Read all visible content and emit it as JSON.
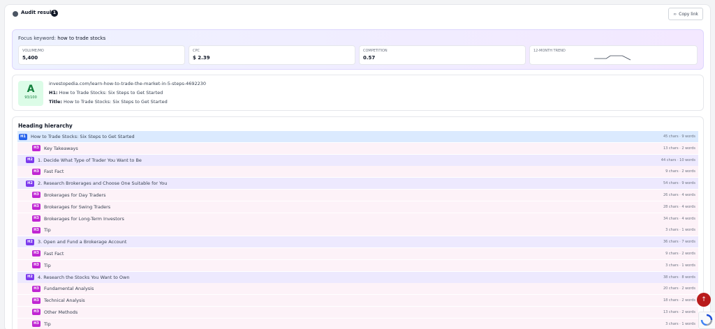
{
  "header": {
    "title": "Audit results",
    "count": "1",
    "copy_label": "Copy link"
  },
  "keyword": {
    "label": "Focus keyword:",
    "value": "how to trade stocks",
    "metrics": [
      {
        "label": "VOLUME/MO",
        "value": "5,400"
      },
      {
        "label": "CPC",
        "value": "$ 2.39"
      },
      {
        "label": "COMPETITION",
        "value": "0.57"
      },
      {
        "label": "12-MONTH TREND",
        "value": ""
      }
    ],
    "trend_values": [
      0.2,
      0.2,
      0.2,
      0.2,
      0.6,
      0.6,
      0.6,
      0.6,
      0.3,
      0.0
    ]
  },
  "page": {
    "grade": "A",
    "score": "93/100",
    "url": "investopedia.com/learn-how-to-trade-the-market-in-5-steps-4692230",
    "h1_label": "H1:",
    "h1": "How to Trade Stocks: Six Steps to Get Started",
    "title_label": "Title:",
    "title": "How to Trade Stocks: Six Steps to Get Started"
  },
  "hierarchy": {
    "title": "Heading hierarchy",
    "rows": [
      {
        "level": "H1",
        "text": "How to Trade Stocks: Six Steps to Get Started",
        "meta": "45 chars · 9 words"
      },
      {
        "level": "H3",
        "text": "Key Takeaways",
        "meta": "13 chars · 2 words"
      },
      {
        "level": "H2",
        "text": "1. Decide What Type of Trader You Want to Be",
        "meta": "44 chars · 10 words"
      },
      {
        "level": "H3",
        "text": "Fast Fact",
        "meta": "9 chars · 2 words"
      },
      {
        "level": "H2",
        "text": "2. Research Brokerages and Choose One Suitable for You",
        "meta": "54 chars · 9 words"
      },
      {
        "level": "H3",
        "text": "Brokerages for Day Traders",
        "meta": "26 chars · 4 words"
      },
      {
        "level": "H3",
        "text": "Brokerages for Swing Traders",
        "meta": "28 chars · 4 words"
      },
      {
        "level": "H3",
        "text": "Brokerages for Long-Term Investors",
        "meta": "34 chars · 4 words"
      },
      {
        "level": "H3",
        "text": "Tip",
        "meta": "3 chars · 1 words"
      },
      {
        "level": "H2",
        "text": "3. Open and Fund a Brokerage Account",
        "meta": "36 chars · 7 words"
      },
      {
        "level": "H3",
        "text": "Fast Fact",
        "meta": "9 chars · 2 words"
      },
      {
        "level": "H3",
        "text": "Tip",
        "meta": "3 chars · 1 words"
      },
      {
        "level": "H2",
        "text": "4. Research the Stocks You Want to Own",
        "meta": "38 chars · 8 words"
      },
      {
        "level": "H3",
        "text": "Fundamental Analysis",
        "meta": "20 chars · 2 words"
      },
      {
        "level": "H3",
        "text": "Technical Analysis",
        "meta": "18 chars · 2 words"
      },
      {
        "level": "H3",
        "text": "Other Methods",
        "meta": "13 chars · 2 words"
      },
      {
        "level": "H3",
        "text": "Tip",
        "meta": "3 chars · 1 words"
      }
    ]
  },
  "floating": {
    "scroll_top_icon": "arrow-up-icon",
    "recaptcha_icon": "recaptcha-icon"
  }
}
